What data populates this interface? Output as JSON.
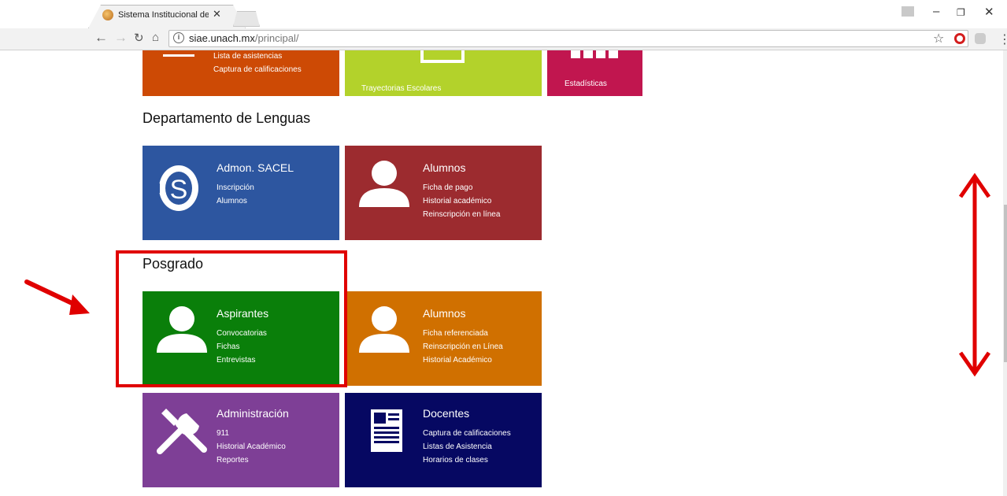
{
  "browser": {
    "tab_title": "Sistema Institucional de",
    "url_host": "siae.unach.mx",
    "url_path": "/principal/"
  },
  "top_row": {
    "tile1": {
      "items": [
        "Lista de asistencias",
        "Captura de calificaciones"
      ],
      "color": "#cd4a05"
    },
    "tile2": {
      "label": "Trayectorias Escolares",
      "color": "#b3d22b"
    },
    "tile3": {
      "label": "Estadísticas",
      "color": "#c1164f"
    }
  },
  "lenguas": {
    "title": "Departamento de Lenguas",
    "sacel": {
      "title": "Admon. SACEL",
      "items": [
        "Inscripción",
        "Alumnos"
      ],
      "color": "#2d56a0"
    },
    "alumnos": {
      "title": "Alumnos",
      "items": [
        "Ficha de pago",
        "Historial académico",
        "Reinscripción en línea"
      ],
      "color": "#9c2b2f"
    }
  },
  "posgrado": {
    "title": "Posgrado",
    "aspirantes": {
      "title": "Aspirantes",
      "items": [
        "Convocatorias",
        "Fichas",
        "Entrevistas"
      ],
      "color": "#0a7f0a"
    },
    "alumnos": {
      "title": "Alumnos",
      "items": [
        "Ficha referenciada",
        "Reinscripción en Línea",
        "Historial Académico"
      ],
      "color": "#d07000"
    }
  },
  "otros": {
    "admin": {
      "title": "Administración",
      "items": [
        "911",
        "Historial Académico",
        "Reportes"
      ],
      "color": "#7e3f96"
    },
    "docentes": {
      "title": "Docentes",
      "items": [
        "Captura de calificaciones",
        "Listas de Asistencia",
        "Horarios de clases"
      ],
      "color": "#060862"
    }
  },
  "annotation_color": "#e00000"
}
